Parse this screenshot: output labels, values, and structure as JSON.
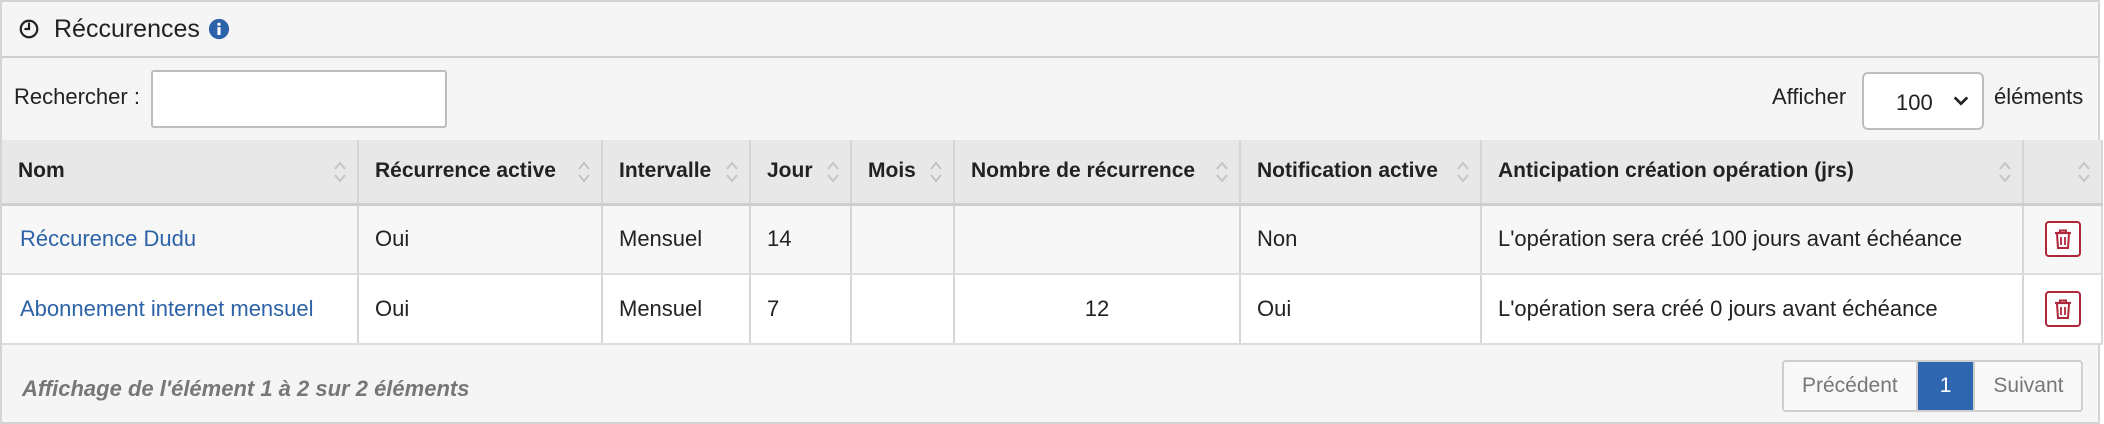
{
  "panel": {
    "title": "Réccurences",
    "clock_icon": "clock-icon",
    "info_icon": "info-icon"
  },
  "search": {
    "label": "Rechercher :",
    "value": "",
    "placeholder": ""
  },
  "length": {
    "prefix": "Afficher",
    "selected": "100",
    "suffix": "éléments"
  },
  "table": {
    "headers": [
      "Nom",
      "Récurrence active",
      "Intervalle",
      "Jour",
      "Mois",
      "Nombre de récurrence",
      "Notification active",
      "Anticipation création opération (jrs)",
      ""
    ],
    "rows": [
      {
        "nom": "Réccurence Dudu",
        "active": "Oui",
        "intervalle": "Mensuel",
        "jour": "14",
        "mois": "",
        "nombre": "",
        "notification": "Non",
        "anticipation": "L'opération sera créé 100 jours avant échéance",
        "action_icon": "trash-icon"
      },
      {
        "nom": "Abonnement internet mensuel",
        "active": "Oui",
        "intervalle": "Mensuel",
        "jour": "7",
        "mois": "",
        "nombre": "12",
        "notification": "Oui",
        "anticipation": "L'opération sera créé 0 jours avant échéance",
        "action_icon": "trash-icon"
      }
    ]
  },
  "footer": {
    "info": "Affichage de l'élément 1 à 2 sur 2 éléments",
    "prev": "Précédent",
    "current": "1",
    "next": "Suivant"
  },
  "colors": {
    "link": "#2c63a8",
    "accent": "#2f66b0",
    "danger": "#b0263b"
  }
}
